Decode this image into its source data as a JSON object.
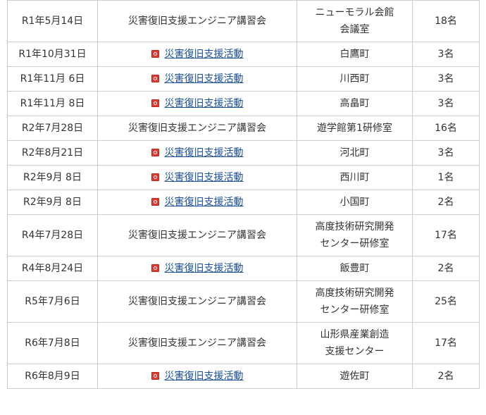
{
  "rows": [
    {
      "date": "R1年5月14日",
      "activity": "災害復旧支援エンジニア講習会",
      "is_link": false,
      "place_lines": [
        "ニューモラル会館",
        "会議室"
      ],
      "count": "18名"
    },
    {
      "date": "R1年10月31日",
      "activity": "災害復旧支援活動",
      "is_link": true,
      "place_lines": [
        "白鷹町"
      ],
      "count": "3名"
    },
    {
      "date": "R1年11月 6日",
      "activity": "災害復旧支援活動",
      "is_link": true,
      "place_lines": [
        "川西町"
      ],
      "count": "3名"
    },
    {
      "date": "R1年11月 8日",
      "activity": "災害復旧支援活動",
      "is_link": true,
      "place_lines": [
        "高畠町"
      ],
      "count": "3名"
    },
    {
      "date": "R2年7月28日",
      "activity": "災害復旧支援エンジニア講習会",
      "is_link": false,
      "place_lines": [
        "遊学館第1研修室"
      ],
      "count": "16名"
    },
    {
      "date": "R2年8月21日",
      "activity": "災害復旧支援活動",
      "is_link": true,
      "place_lines": [
        "河北町"
      ],
      "count": "3名"
    },
    {
      "date": "R2年9月 8日",
      "activity": "災害復旧支援活動",
      "is_link": true,
      "place_lines": [
        "西川町"
      ],
      "count": "1名"
    },
    {
      "date": "R2年9月 8日",
      "activity": "災害復旧支援活動",
      "is_link": true,
      "place_lines": [
        "小国町"
      ],
      "count": "2名"
    },
    {
      "date": "R4年7月28日",
      "activity": "災害復旧支援エンジニア講習会",
      "is_link": false,
      "place_lines": [
        "高度技術研究開発",
        "センター研修室"
      ],
      "count": "17名"
    },
    {
      "date": "R4年8月24日",
      "activity": "災害復旧支援活動",
      "is_link": true,
      "place_lines": [
        "飯豊町"
      ],
      "count": "2名"
    },
    {
      "date": "R5年7月6日",
      "activity": "災害復旧支援エンジニア講習会",
      "is_link": false,
      "place_lines": [
        "高度技術研究開発",
        "センター研修室"
      ],
      "count": "25名"
    },
    {
      "date": "R6年7月8日",
      "activity": "災害復旧支援エンジニア講習会",
      "is_link": false,
      "place_lines": [
        "山形県産業創造",
        "支援センター"
      ],
      "count": "17名"
    },
    {
      "date": "R6年8月9日",
      "activity": "災害復旧支援活動",
      "is_link": true,
      "place_lines": [
        "遊佐町"
      ],
      "count": "2名"
    }
  ]
}
